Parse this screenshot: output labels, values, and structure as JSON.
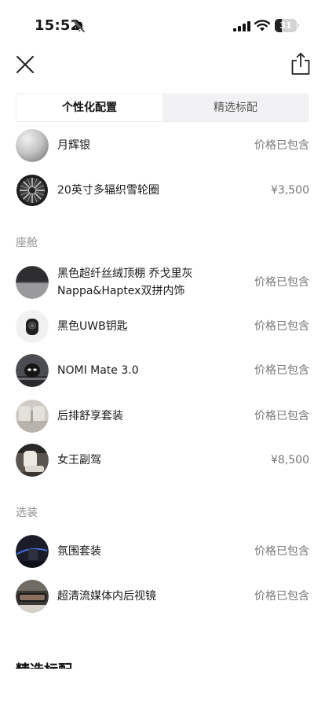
{
  "status": {
    "time": "15:52",
    "battery": "31",
    "battery_level": 0.31
  },
  "tabs": [
    {
      "label": "个性化配置",
      "active": true
    },
    {
      "label": "精选标配",
      "active": false
    }
  ],
  "top_items": [
    {
      "name": "月辉银",
      "price": "价格已包含",
      "icon": "silver-paint-swatch-icon"
    },
    {
      "name": "20英寸多辐织雪轮圈",
      "price": "¥3,500",
      "icon": "wheel-rim-icon"
    }
  ],
  "cabin": {
    "title": "座舱",
    "items": [
      {
        "name_line1": "黑色超纤丝绒顶棚 乔戈里灰",
        "name_line2": "Nappa&Haptex双拼内饰",
        "price": "价格已包含",
        "icon": "interior-swatch-icon"
      },
      {
        "name": "黑色UWB钥匙",
        "price": "价格已包含",
        "icon": "car-key-icon"
      },
      {
        "name": "NOMI Mate 3.0",
        "price": "价格已包含",
        "icon": "nomi-robot-icon"
      },
      {
        "name": "后排舒享套装",
        "price": "价格已包含",
        "icon": "rear-seat-icon"
      },
      {
        "name": "女王副驾",
        "price": "¥8,500",
        "icon": "passenger-seat-icon"
      }
    ]
  },
  "options": {
    "title": "选装",
    "items": [
      {
        "name": "氛围套装",
        "price": "价格已包含",
        "icon": "ambient-light-icon"
      },
      {
        "name": "超清流媒体内后视镜",
        "price": "价格已包含",
        "icon": "rearview-mirror-icon"
      }
    ]
  },
  "next_section_title": "精选标配",
  "colors": {
    "background": "#ffffff",
    "price_text": "#777777",
    "section_text": "#8e8e93",
    "tab_bg": "#f2f2f4"
  }
}
